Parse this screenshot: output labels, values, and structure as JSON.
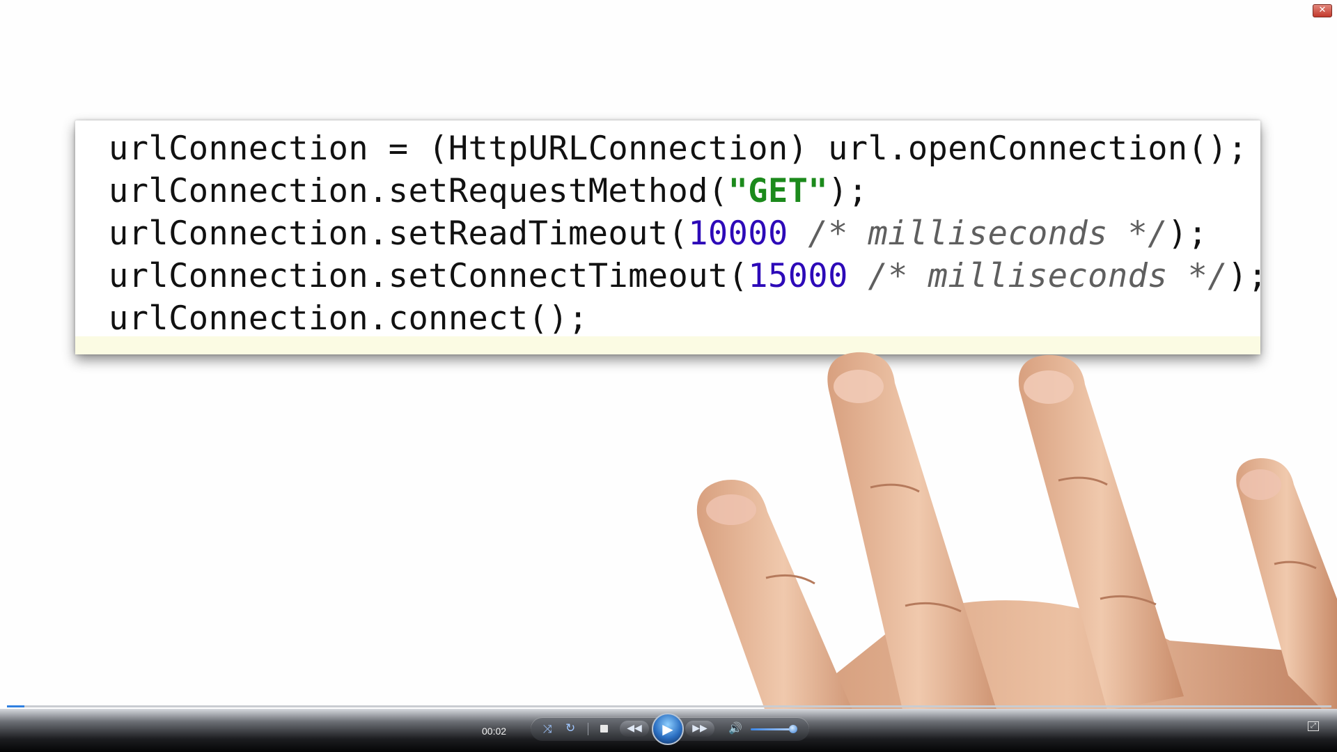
{
  "window": {
    "close_glyph": "✕"
  },
  "code": {
    "lines": [
      [
        {
          "t": "urlConnection = (HttpURLConnection) url.openConnection();",
          "k": "plain"
        }
      ],
      [
        {
          "t": "urlConnection.setRequestMethod(",
          "k": "plain"
        },
        {
          "t": "\"GET\"",
          "k": "str"
        },
        {
          "t": ");",
          "k": "plain"
        }
      ],
      [
        {
          "t": "urlConnection.setReadTimeout(",
          "k": "plain"
        },
        {
          "t": "10000",
          "k": "num"
        },
        {
          "t": " /* milliseconds */",
          "k": "cmt"
        },
        {
          "t": ");",
          "k": "plain"
        }
      ],
      [
        {
          "t": "urlConnection.setConnectTimeout(",
          "k": "plain"
        },
        {
          "t": "15000",
          "k": "num"
        },
        {
          "t": " /* milliseconds */",
          "k": "cmt"
        },
        {
          "t": ");",
          "k": "plain"
        }
      ],
      [
        {
          "t": "urlConnection.connect();",
          "k": "plain"
        }
      ]
    ],
    "colors": {
      "string": "#1c8a1c",
      "number": "#2d0ab8",
      "comment": "#5f5f5f"
    }
  },
  "player": {
    "time": "00:02",
    "progress_fraction": 0.013,
    "volume_fraction": 0.85,
    "icons": {
      "shuffle": "shuffle-icon",
      "repeat": "repeat-icon",
      "stop": "stop-icon",
      "previous": "rewind-icon",
      "play": "play-icon",
      "next": "fast-forward-icon",
      "volume": "volume-icon",
      "fullscreen": "fullscreen-icon"
    },
    "glyphs": {
      "shuffle": "⤨",
      "repeat": "↻",
      "previous": "◀◀",
      "play": "▶",
      "next": "▶▶",
      "volume": "🔊",
      "fullscreen": "⤢"
    },
    "accent": "#2f7fe0"
  }
}
